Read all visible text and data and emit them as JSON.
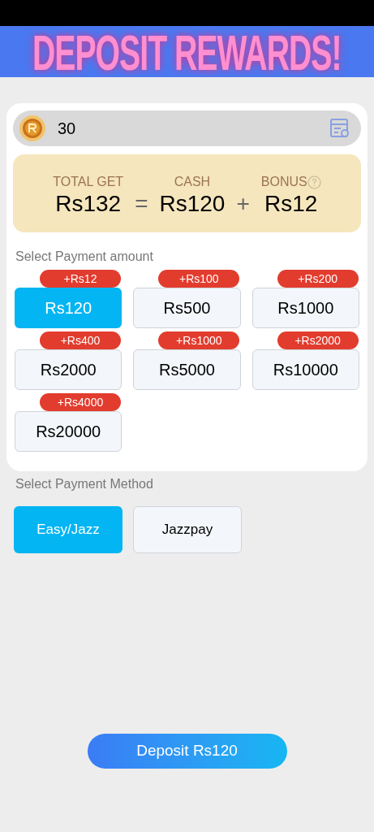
{
  "overlay": {
    "text": "DEPOSIT REWARDS!"
  },
  "balance": {
    "amount": "30"
  },
  "summary": {
    "total_label": "TOTAL GET",
    "total": "Rs132",
    "equals": "=",
    "cash_label": "CASH",
    "cash": "Rs120",
    "plus": "+",
    "bonus_label": "BONUS",
    "bonus": "Rs12"
  },
  "amount_section": {
    "title": "Select Payment amount",
    "options": [
      {
        "label": "Rs120",
        "badge": "+Rs12",
        "selected": true
      },
      {
        "label": "Rs500",
        "badge": "+Rs100",
        "selected": false
      },
      {
        "label": "Rs1000",
        "badge": "+Rs200",
        "selected": false
      },
      {
        "label": "Rs2000",
        "badge": "+Rs400",
        "selected": false
      },
      {
        "label": "Rs5000",
        "badge": "+Rs1000",
        "selected": false
      },
      {
        "label": "Rs10000",
        "badge": "+Rs2000",
        "selected": false
      },
      {
        "label": "Rs20000",
        "badge": "+Rs4000",
        "selected": false
      }
    ]
  },
  "method_section": {
    "title": "Select Payment Method",
    "options": [
      {
        "label": "Easy/Jazz",
        "selected": true
      },
      {
        "label": "Jazzpay",
        "selected": false
      }
    ]
  },
  "deposit_button": {
    "label": "Deposit Rs120"
  }
}
